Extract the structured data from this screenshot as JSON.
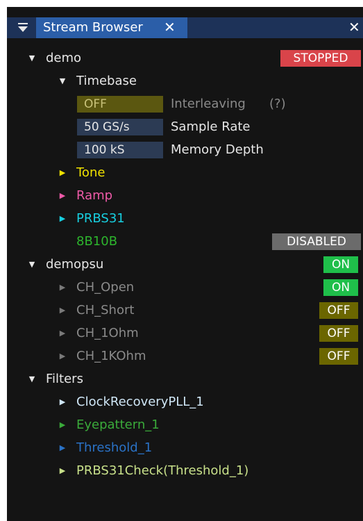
{
  "window": {
    "tab_title": "Stream Browser",
    "tab_close": "✕",
    "panel_close": "✕"
  },
  "tree": {
    "demo": {
      "label": "demo",
      "status": "STOPPED"
    },
    "timebase": {
      "label": "Timebase",
      "interleaving": {
        "value": "OFF",
        "label": "Interleaving",
        "help": "(?)"
      },
      "sample_rate": {
        "value": "50 GS/s",
        "label": "Sample Rate"
      },
      "memory_depth": {
        "value": "100 kS",
        "label": "Memory Depth"
      }
    },
    "streams": [
      {
        "label": "Tone"
      },
      {
        "label": "Ramp"
      },
      {
        "label": "PRBS31"
      }
    ],
    "b8b10": {
      "label": "8B10B",
      "status": "DISABLED"
    },
    "demopsu": {
      "label": "demopsu",
      "status": "ON",
      "channels": [
        {
          "label": "CH_Open",
          "status": "ON"
        },
        {
          "label": "CH_Short",
          "status": "OFF"
        },
        {
          "label": "CH_1Ohm",
          "status": "OFF"
        },
        {
          "label": "CH_1KOhm",
          "status": "OFF"
        }
      ]
    },
    "filters": {
      "label": "Filters",
      "items": [
        {
          "label": "ClockRecoveryPLL_1"
        },
        {
          "label": "Eyepattern_1"
        },
        {
          "label": "Threshold_1"
        },
        {
          "label": "PRBS31Check(Threshold_1)"
        }
      ]
    }
  },
  "colors": {
    "panel_bg": "#141414",
    "tabbar_bg": "#1d3258",
    "tab_active": "#2b5ea8",
    "text": "#e6e6e6",
    "text_dim": "#8a8a8a",
    "stopped_bg": "#d9444a",
    "on_bg": "#1fbf4a",
    "off_bg": "#6b6600",
    "disabled_bg": "#6b6b6b",
    "field_off_bg": "#5b5710",
    "field_bg": "#2c3b54",
    "tone": "#f0e100",
    "ramp": "#ee5aa8",
    "prbs31": "#17cfe0",
    "b8b10": "#2db52d",
    "clock": "#cfe6f6",
    "eye": "#3aaa3a",
    "threshold": "#2a72c6",
    "prbscheck": "#c8e08a"
  }
}
